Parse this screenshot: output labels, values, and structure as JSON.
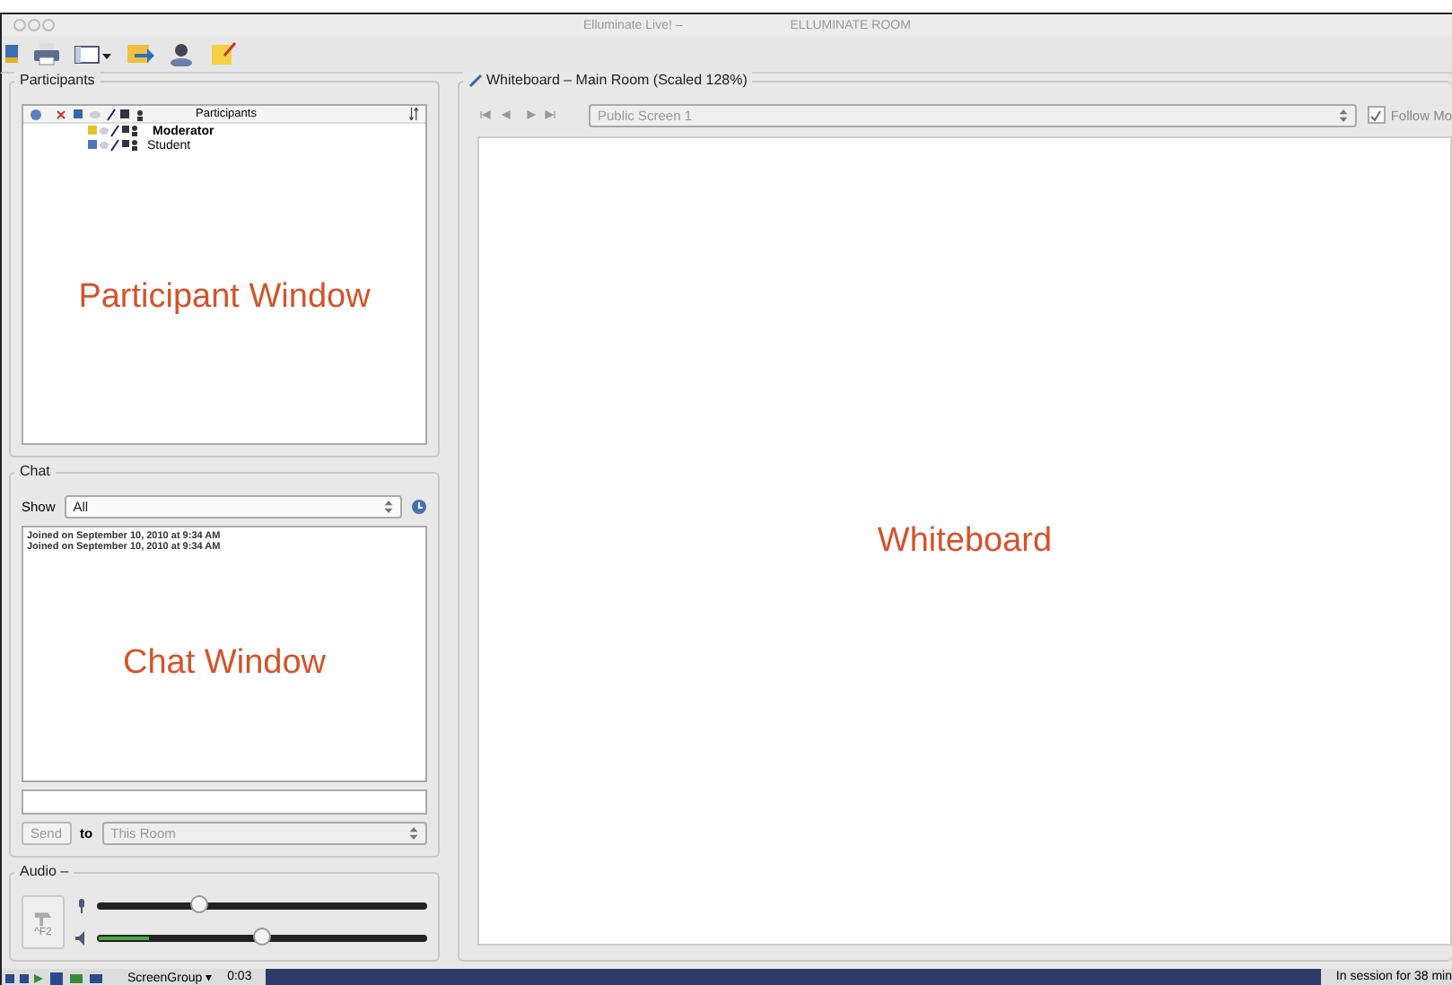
{
  "window": {
    "title": "Elluminate Live! –",
    "room": "ELLUMINATE ROOM"
  },
  "participants": {
    "title": "Participants",
    "column_header": "Participants",
    "annotation": "Participant Window",
    "rows": [
      {
        "name": "Moderator",
        "kind": "moderator"
      },
      {
        "name": "Student",
        "kind": "student"
      }
    ]
  },
  "chat": {
    "title": "Chat",
    "show_label": "Show",
    "show_value": "All",
    "annotation": "Chat Window",
    "send": "Send",
    "to_label": "to",
    "to_value": "This Room",
    "messages": [
      "Joined on September 10, 2010 at 9:34 AM",
      "Joined on September 10, 2010 at 9:34 AM"
    ]
  },
  "audio": {
    "title": "Audio –",
    "talk_key": "^F2",
    "microphone": {
      "level": 0.31
    },
    "speaker": {
      "level": 0.5,
      "meter": {
        "level": 0.15
      }
    }
  },
  "whiteboard": {
    "title": "Whiteboard – Main Room (Scaled 128%)",
    "screen": "Public Screen 1",
    "follow": {
      "label": "Follow Mo",
      "checked": true
    },
    "annotation": "Whiteboard"
  },
  "status_bar": {
    "group": "ScreenGroup ▾",
    "time": "0:03",
    "session": "In session for 38 min"
  }
}
